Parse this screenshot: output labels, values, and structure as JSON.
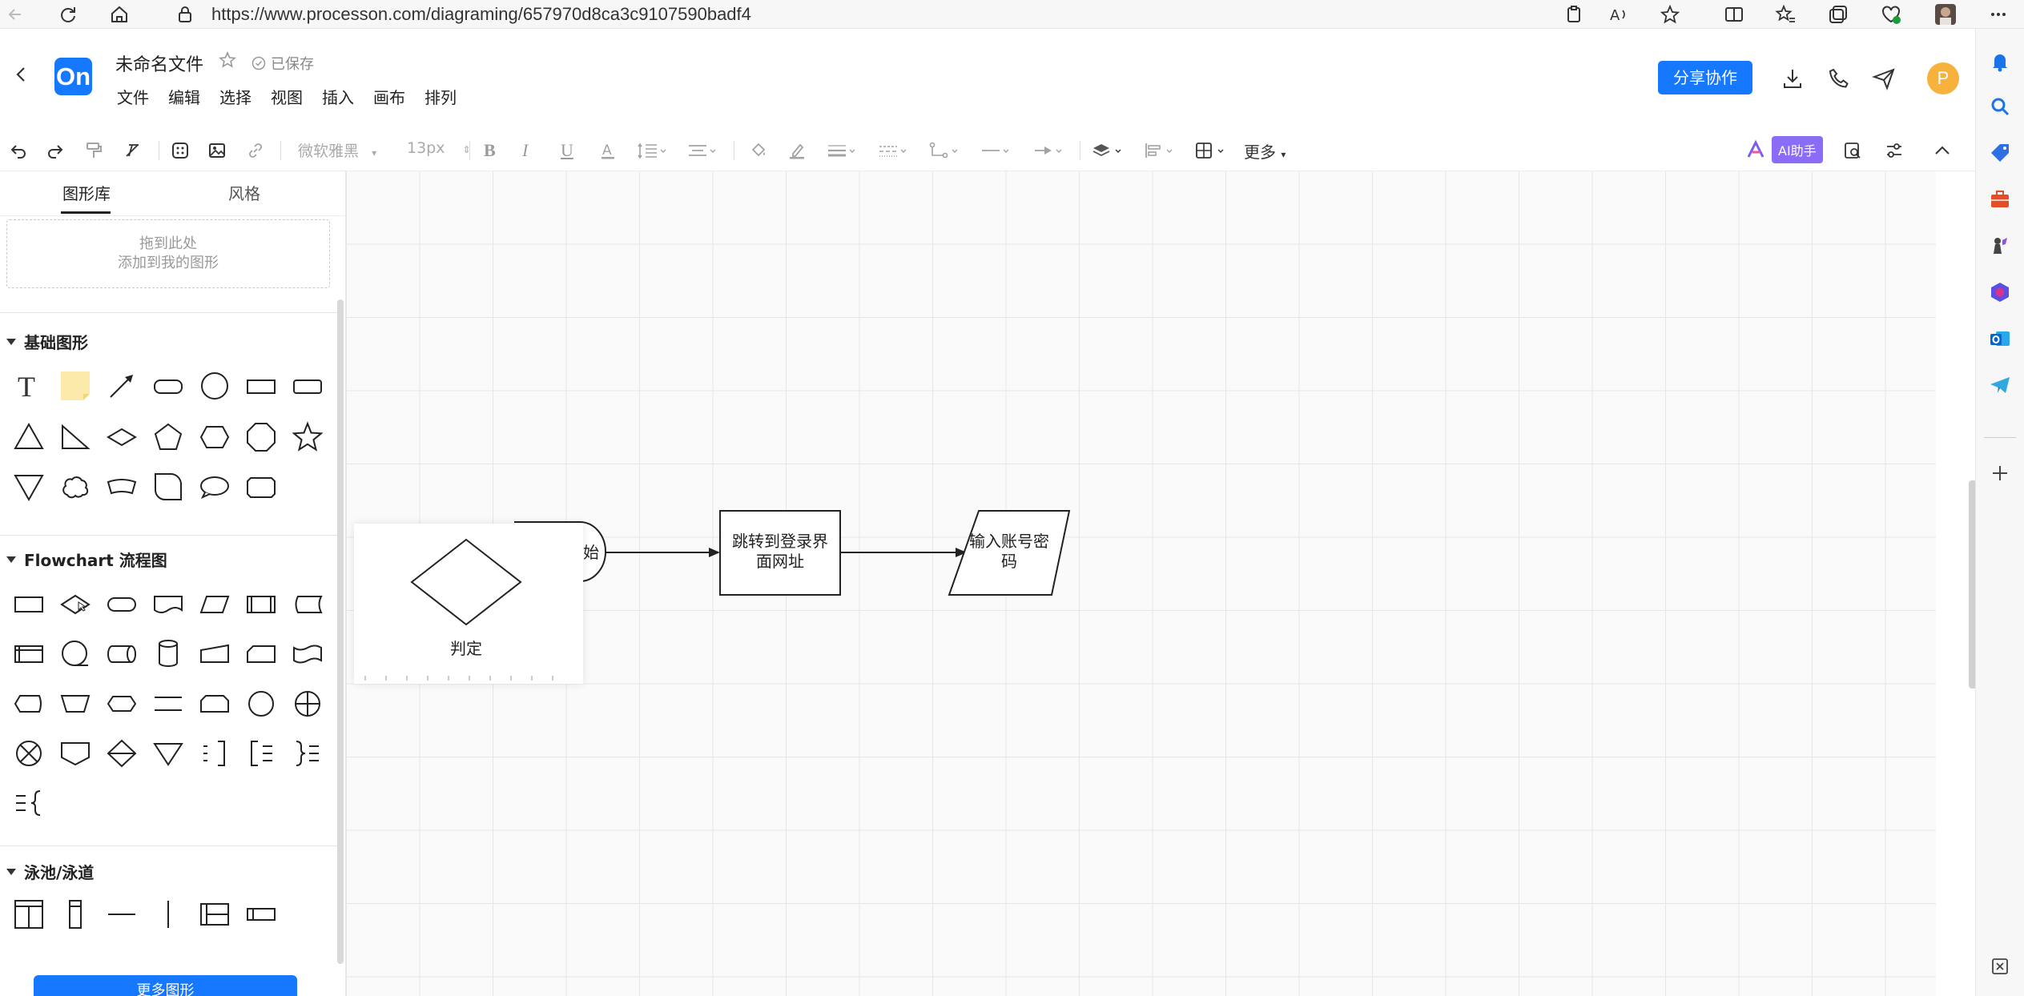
{
  "browser": {
    "url": "https://www.processon.com/diagraming/657970d8ca3c9107590badf4"
  },
  "header": {
    "logo_text": "On",
    "doc_title": "未命名文件",
    "saved_status": "已保存",
    "menus": [
      "文件",
      "编辑",
      "选择",
      "视图",
      "插入",
      "画布",
      "排列"
    ],
    "share_button": "分享协作",
    "avatar_letter": "P",
    "brand_color": "#1677ff"
  },
  "toolbar": {
    "font_name": "微软雅黑",
    "font_size": "13px",
    "more_label": "更多",
    "ai_label": "AI助手"
  },
  "left_panel": {
    "tabs": [
      "图形库",
      "风格"
    ],
    "dropzone_line1": "拖到此处",
    "dropzone_line2": "添加到我的图形",
    "sections": {
      "basic": "基础图形",
      "flowchart": "Flowchart 流程图",
      "swimlane": "泳池/泳道"
    },
    "more_shapes_button": "更多图形"
  },
  "canvas": {
    "node_partial": "始",
    "node_login_url": [
      "跳转到登录界",
      "面网址"
    ],
    "node_input": [
      "输入账号密",
      "码"
    ],
    "preview_label": "判定"
  }
}
